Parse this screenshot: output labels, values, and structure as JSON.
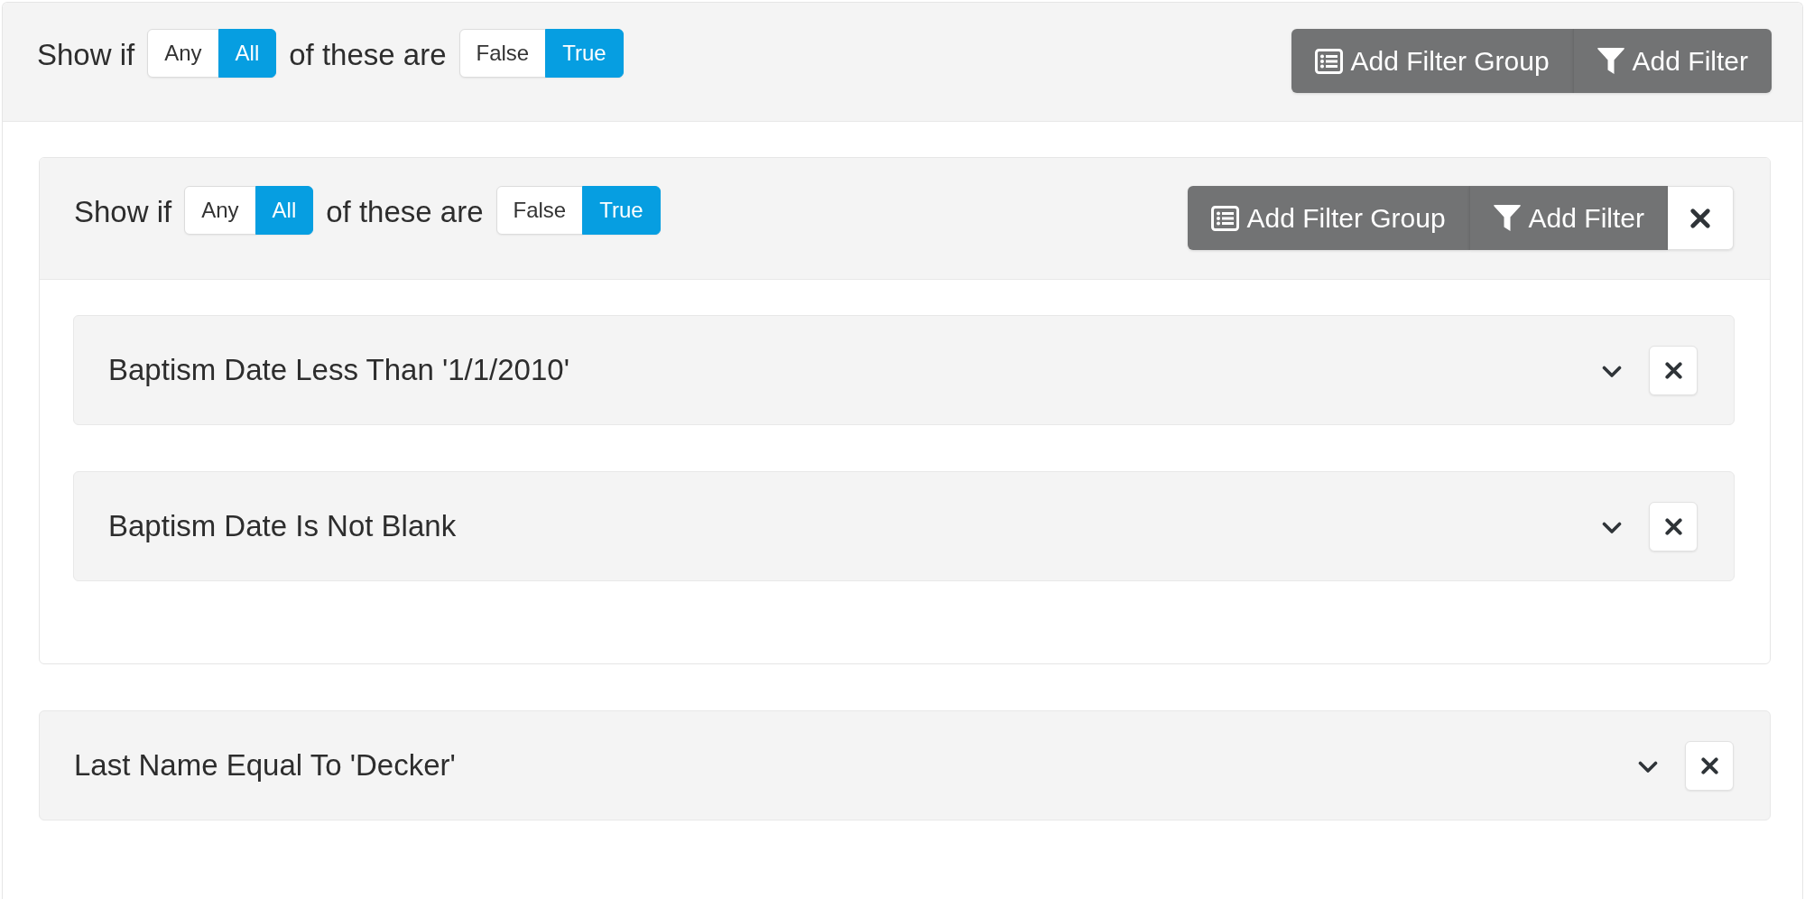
{
  "filter_group": {
    "removable": false,
    "header": {
      "show_if_label": "Show if",
      "match_options": [
        {
          "label": "Any",
          "selected": false
        },
        {
          "label": "All",
          "selected": true
        }
      ],
      "of_these_label": "of these are",
      "result_options": [
        {
          "label": "False",
          "selected": false
        },
        {
          "label": "True",
          "selected": true
        }
      ],
      "buttons": [
        {
          "kind": "add_group",
          "label": "Add Filter Group"
        },
        {
          "kind": "add_filter",
          "label": "Add Filter"
        }
      ]
    },
    "items": [
      {
        "kind": "group",
        "removable": true,
        "header": {
          "show_if_label": "Show if",
          "match_options": [
            {
              "label": "Any",
              "selected": false
            },
            {
              "label": "All",
              "selected": true
            }
          ],
          "of_these_label": "of these are",
          "result_options": [
            {
              "label": "False",
              "selected": false
            },
            {
              "label": "True",
              "selected": true
            }
          ],
          "buttons": [
            {
              "kind": "add_group",
              "label": "Add Filter Group"
            },
            {
              "kind": "add_filter",
              "label": "Add Filter"
            }
          ]
        },
        "items": [
          {
            "kind": "filter",
            "label": "Baptism Date Less Than '1/1/2010'",
            "expanded": false
          },
          {
            "kind": "filter",
            "label": "Baptism Date Is Not Blank",
            "expanded": false
          }
        ]
      },
      {
        "kind": "filter",
        "label": "Last Name Equal To 'Decker'",
        "expanded": false
      }
    ]
  }
}
